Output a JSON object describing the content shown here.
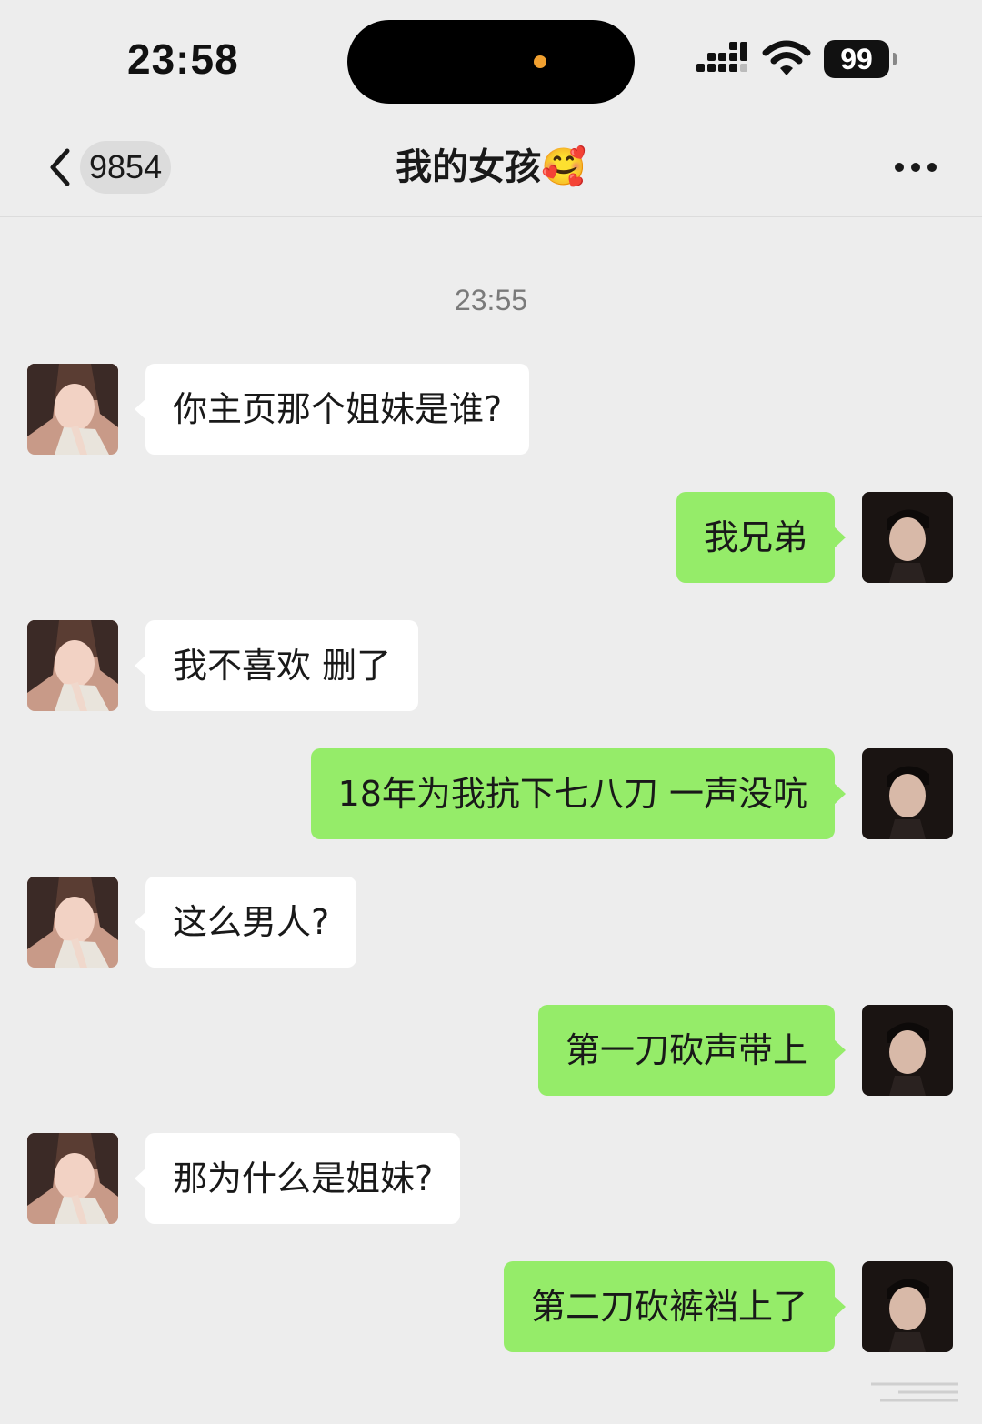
{
  "status_bar": {
    "time": "23:58",
    "battery_level": "99",
    "icons": [
      "signal-icon",
      "wifi-icon",
      "battery-icon"
    ]
  },
  "nav": {
    "unread_count": "9854",
    "title": "我的女孩🥰",
    "back_icon": "chevron-left-icon",
    "more_icon": "more-dots-icon"
  },
  "chat": {
    "timestamp": "23:55",
    "messages": [
      {
        "side": "incoming",
        "text": "你主页那个姐妹是谁?"
      },
      {
        "side": "outgoing",
        "text": "我兄弟"
      },
      {
        "side": "incoming",
        "text": "我不喜欢 删了"
      },
      {
        "side": "outgoing",
        "text": "18年为我抗下七八刀 一声没吭"
      },
      {
        "side": "incoming",
        "text": "这么男人?"
      },
      {
        "side": "outgoing",
        "text": "第一刀砍声带上"
      },
      {
        "side": "incoming",
        "text": "那为什么是姐妹?"
      },
      {
        "side": "outgoing",
        "text": "第二刀砍裤裆上了"
      }
    ]
  },
  "colors": {
    "background": "#ededed",
    "incoming_bubble": "#ffffff",
    "outgoing_bubble": "#95ec69",
    "timestamp_text": "#7a7a7a"
  }
}
